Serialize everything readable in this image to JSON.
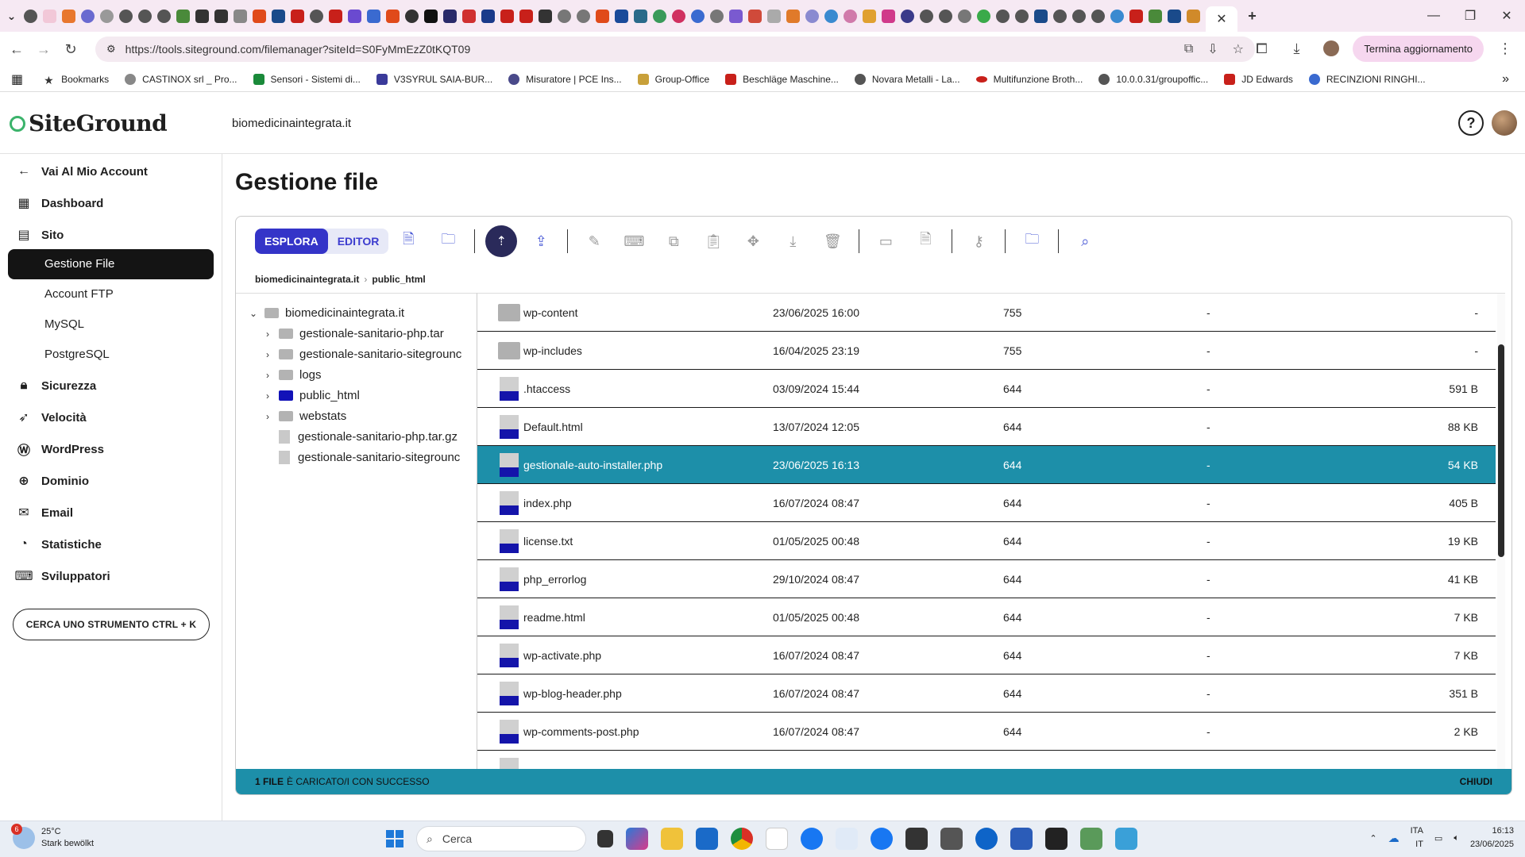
{
  "browser": {
    "url": "https://tools.siteground.com/filemanager?siteId=S0FyMmEzZ0tKQT09",
    "update_label": "Termina aggiornamento",
    "bookmarks": [
      "Bookmarks",
      "CASTINOX srl _ Pro...",
      "Sensori - Sistemi di...",
      "V3SYRUL SAIA-BUR...",
      "Misuratore | PCE Ins...",
      "Group-Office",
      "Beschläge Maschine...",
      "Novara Metalli - La...",
      "Multifunzione Broth...",
      "10.0.0.31/groupoffic...",
      "JD Edwards",
      "RECINZIONI RINGHI..."
    ]
  },
  "header": {
    "logo_text": "SiteGround",
    "site_domain": "biomedicinaintegrata.it"
  },
  "sidebar": {
    "back_label": "Vai Al Mio Account",
    "dashboard": "Dashboard",
    "site": "Sito",
    "site_items": [
      "Gestione File",
      "Account FTP",
      "MySQL",
      "PostgreSQL"
    ],
    "security": "Sicurezza",
    "speed": "Velocità",
    "wordpress": "WordPress",
    "domain": "Dominio",
    "email": "Email",
    "stats": "Statistiche",
    "devs": "Sviluppatori",
    "search_tool": "CERCA UNO STRUMENTO CTRL + K"
  },
  "main": {
    "title": "Gestione file",
    "mode_explore": "ESPLORA",
    "mode_editor": "EDITOR",
    "breadcrumb": [
      "biomedicinaintegrata.it",
      "public_html"
    ],
    "tree": {
      "root": "biomedicinaintegrata.it",
      "items": [
        "gestionale-sanitario-php.tar",
        "gestionale-sanitario-sitegrounc",
        "logs",
        "public_html",
        "webstats",
        "gestionale-sanitario-php.tar.gz",
        "gestionale-sanitario-sitegrounc"
      ]
    },
    "files": [
      {
        "name": "wp-content",
        "date": "23/06/2025 16:00",
        "perm": "755",
        "owner": "-",
        "size": "-"
      },
      {
        "name": "wp-includes",
        "date": "16/04/2025 23:19",
        "perm": "755",
        "owner": "-",
        "size": "-"
      },
      {
        "name": ".htaccess",
        "date": "03/09/2024 15:44",
        "perm": "644",
        "owner": "-",
        "size": "591 B"
      },
      {
        "name": "Default.html",
        "date": "13/07/2024 12:05",
        "perm": "644",
        "owner": "-",
        "size": "88 KB"
      },
      {
        "name": "gestionale-auto-installer.php",
        "date": "23/06/2025 16:13",
        "perm": "644",
        "owner": "-",
        "size": "54 KB"
      },
      {
        "name": "index.php",
        "date": "16/07/2024 08:47",
        "perm": "644",
        "owner": "-",
        "size": "405 B"
      },
      {
        "name": "license.txt",
        "date": "01/05/2025 00:48",
        "perm": "644",
        "owner": "-",
        "size": "19 KB"
      },
      {
        "name": "php_errorlog",
        "date": "29/10/2024 08:47",
        "perm": "644",
        "owner": "-",
        "size": "41 KB"
      },
      {
        "name": "readme.html",
        "date": "01/05/2025 00:48",
        "perm": "644",
        "owner": "-",
        "size": "7 KB"
      },
      {
        "name": "wp-activate.php",
        "date": "16/07/2024 08:47",
        "perm": "644",
        "owner": "-",
        "size": "7 KB"
      },
      {
        "name": "wp-blog-header.php",
        "date": "16/07/2024 08:47",
        "perm": "644",
        "owner": "-",
        "size": "351 B"
      },
      {
        "name": "wp-comments-post.php",
        "date": "16/07/2024 08:47",
        "perm": "644",
        "owner": "-",
        "size": "2 KB"
      }
    ],
    "status_count": "1 FILE",
    "status_text": "È CARICATO/I CON SUCCESSO",
    "status_close": "CHIUDI"
  },
  "taskbar": {
    "temp": "25°C",
    "weather": "Stark bewölkt",
    "weather_badge": "6",
    "search_placeholder": "Cerca",
    "lang1": "ITA",
    "lang2": "IT",
    "time": "16:13",
    "date": "23/06/2025"
  }
}
